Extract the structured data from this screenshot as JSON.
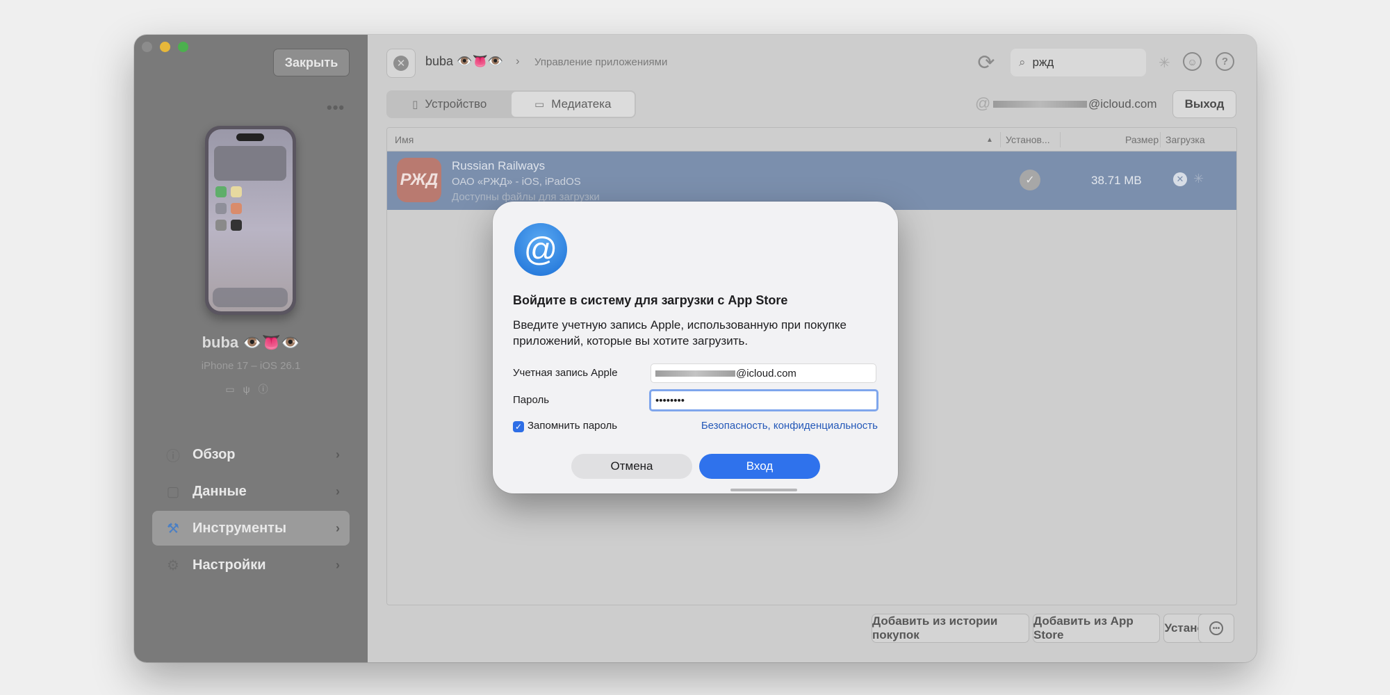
{
  "sidebar": {
    "close_label": "Закрыть",
    "more_label": "•••",
    "device_name": "buba 👁️👅👁️",
    "device_model": "iPhone 17 – iOS 26.1",
    "device_status_icons": [
      "battery-icon",
      "usb-icon",
      "info-icon"
    ],
    "items": [
      {
        "label": "Обзор",
        "icon": "info-icon",
        "active": false
      },
      {
        "label": "Данные",
        "icon": "square-icon",
        "active": false
      },
      {
        "label": "Инструменты",
        "icon": "tools-icon",
        "active": true
      },
      {
        "label": "Настройки",
        "icon": "gear-icon",
        "active": false
      }
    ]
  },
  "header": {
    "device": "buba 👁️👅👁️",
    "separator": "›",
    "page": "Управление приложениями",
    "search_value": "ржд"
  },
  "tabs": [
    {
      "label": "Устройство",
      "icon": "phone-icon",
      "selected": false
    },
    {
      "label": "Медиатека",
      "icon": "monitor-icon",
      "selected": true
    }
  ],
  "account": {
    "email_suffix": "@icloud.com",
    "logout_label": "Выход"
  },
  "table": {
    "columns": [
      "Имя",
      "Установ...",
      "Размер",
      "Загрузка"
    ],
    "rows": [
      {
        "icon_text": "РЖД",
        "name": "Russian Railways",
        "publisher": "ОАО «РЖД» - iOS, iPadOS",
        "status": "Доступны файлы для загрузки",
        "installed": true,
        "size": "38.71 MB"
      }
    ]
  },
  "footer": {
    "add_history_label": "Добавить из истории покупок",
    "add_store_label": "Добавить из App Store",
    "install_label": "Установить"
  },
  "dialog": {
    "icon": "@",
    "title": "Войдите в систему для загрузки с App Store",
    "description": "Введите учетную запись Apple, использованную при покупке приложений, которые вы хотите загрузить.",
    "account_label": "Учетная запись Apple",
    "account_suffix": "@icloud.com",
    "password_label": "Пароль",
    "password_value": "••••••••",
    "remember_label": "Запомнить пароль",
    "remember_checked": true,
    "privacy_link": "Безопасность, конфиденциальность",
    "cancel_label": "Отмена",
    "login_label": "Вход"
  },
  "colors": {
    "accent": "#2f72ec",
    "selected_row": "#7b8fad",
    "link": "#2458b8"
  }
}
